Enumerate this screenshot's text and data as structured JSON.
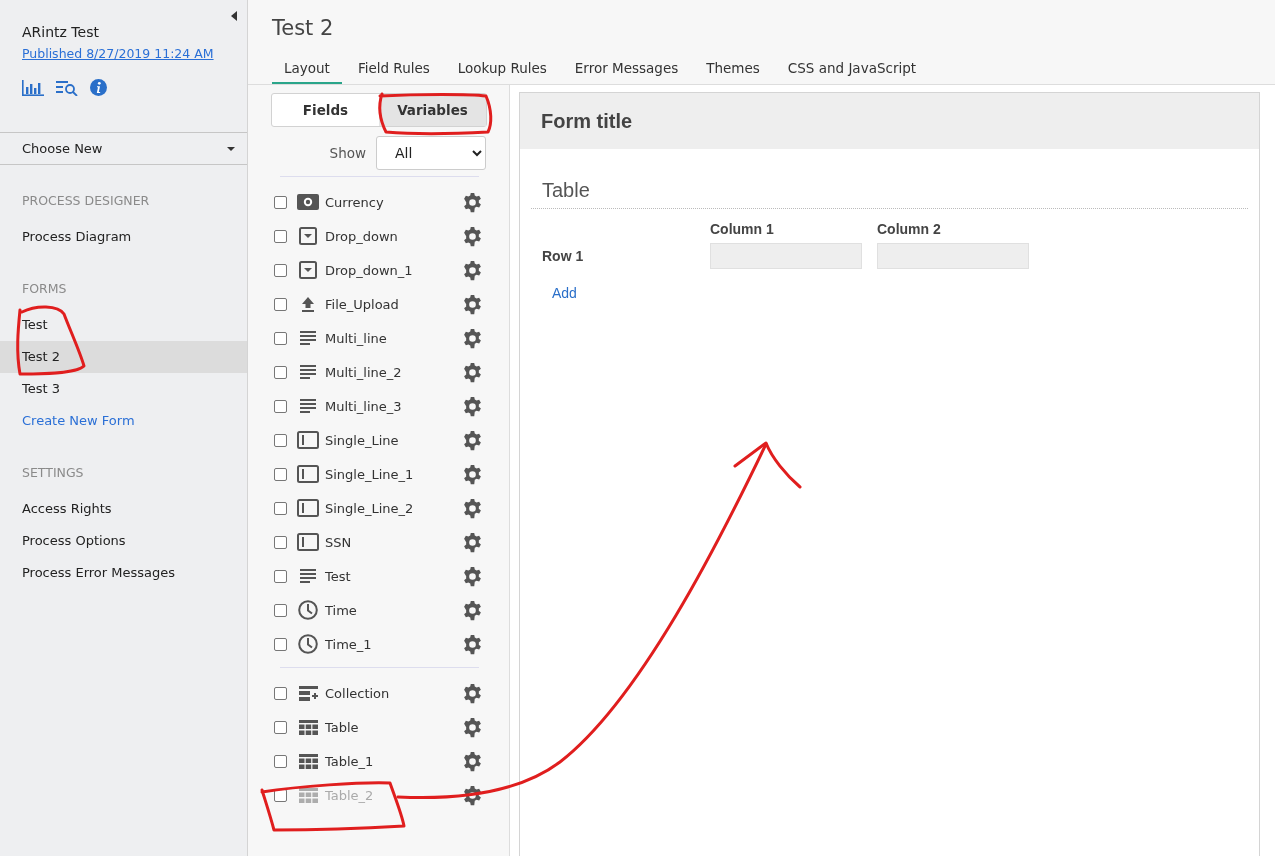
{
  "sidebar": {
    "app_title": "ARintz Test",
    "published_link": "Published 8/27/2019 11:24 AM",
    "choose_new": "Choose New",
    "sections": [
      {
        "heading": "PROCESS DESIGNER",
        "items": [
          {
            "label": "Process Diagram",
            "kind": "item",
            "selected": false
          }
        ]
      },
      {
        "heading": "FORMS",
        "items": [
          {
            "label": "Test",
            "kind": "item",
            "selected": false
          },
          {
            "label": "Test 2",
            "kind": "item",
            "selected": true
          },
          {
            "label": "Test 3",
            "kind": "item",
            "selected": false
          },
          {
            "label": "Create New Form",
            "kind": "link",
            "selected": false
          }
        ]
      },
      {
        "heading": "SETTINGS",
        "items": [
          {
            "label": "Access Rights",
            "kind": "item",
            "selected": false
          },
          {
            "label": "Process Options",
            "kind": "item",
            "selected": false
          },
          {
            "label": "Process Error Messages",
            "kind": "item",
            "selected": false
          }
        ]
      }
    ]
  },
  "page_title": "Test 2",
  "tabs": [
    {
      "label": "Layout",
      "selected": true
    },
    {
      "label": "Field Rules",
      "selected": false
    },
    {
      "label": "Lookup Rules",
      "selected": false
    },
    {
      "label": "Error Messages",
      "selected": false
    },
    {
      "label": "Themes",
      "selected": false
    },
    {
      "label": "CSS and JavaScript",
      "selected": false
    }
  ],
  "panel": {
    "toggle": [
      {
        "label": "Fields",
        "selected": false
      },
      {
        "label": "Variables",
        "selected": true
      }
    ],
    "show_label": "Show",
    "show_value": "All",
    "groups": [
      [
        {
          "name": "Currency",
          "kind": "currency",
          "checked": false,
          "disabled": false
        },
        {
          "name": "Drop_down",
          "kind": "dropdown",
          "checked": false,
          "disabled": false
        },
        {
          "name": "Drop_down_1",
          "kind": "dropdown",
          "checked": false,
          "disabled": false
        },
        {
          "name": "File_Upload",
          "kind": "upload",
          "checked": false,
          "disabled": false
        },
        {
          "name": "Multi_line",
          "kind": "multiline",
          "checked": false,
          "disabled": false
        },
        {
          "name": "Multi_line_2",
          "kind": "multiline",
          "checked": false,
          "disabled": false
        },
        {
          "name": "Multi_line_3",
          "kind": "multiline",
          "checked": false,
          "disabled": false
        },
        {
          "name": "Single_Line",
          "kind": "singleline",
          "checked": false,
          "disabled": false
        },
        {
          "name": "Single_Line_1",
          "kind": "singleline",
          "checked": false,
          "disabled": false
        },
        {
          "name": "Single_Line_2",
          "kind": "singleline",
          "checked": false,
          "disabled": false
        },
        {
          "name": "SSN",
          "kind": "singleline",
          "checked": false,
          "disabled": false
        },
        {
          "name": "Test",
          "kind": "multiline",
          "checked": false,
          "disabled": false
        },
        {
          "name": "Time",
          "kind": "time",
          "checked": false,
          "disabled": false
        },
        {
          "name": "Time_1",
          "kind": "time",
          "checked": false,
          "disabled": false
        }
      ],
      [
        {
          "name": "Collection",
          "kind": "collection",
          "checked": false,
          "disabled": false
        },
        {
          "name": "Table",
          "kind": "table",
          "checked": false,
          "disabled": false
        },
        {
          "name": "Table_1",
          "kind": "table",
          "checked": false,
          "disabled": false
        },
        {
          "name": "Table_2",
          "kind": "table",
          "checked": false,
          "disabled": true
        }
      ]
    ]
  },
  "form": {
    "title": "Form title",
    "section_title": "Table",
    "columns": [
      "Column 1",
      "Column 2"
    ],
    "rows": [
      {
        "label": "Row 1",
        "cells": [
          "",
          ""
        ]
      }
    ],
    "add_link": "Add"
  }
}
